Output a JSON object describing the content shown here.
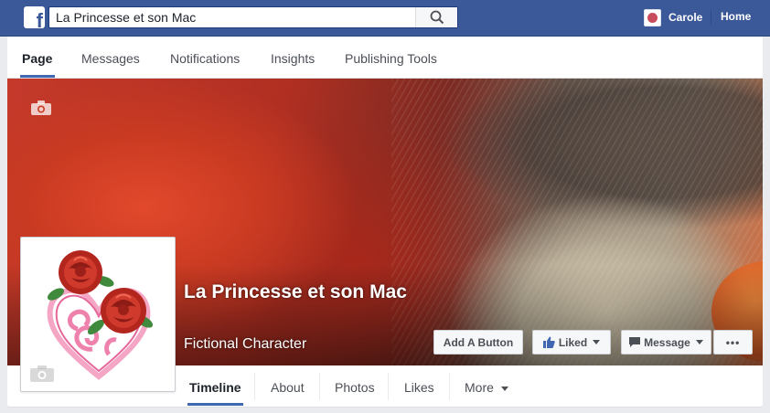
{
  "search": {
    "value": "La Princesse et son Mac"
  },
  "topbar": {
    "user_name": "Carole",
    "home_label": "Home"
  },
  "page_tabs": [
    {
      "label": "Page",
      "active": true
    },
    {
      "label": "Messages"
    },
    {
      "label": "Notifications"
    },
    {
      "label": "Insights"
    },
    {
      "label": "Publishing Tools"
    }
  ],
  "page": {
    "name": "La Princesse et son Mac",
    "category": "Fictional Character"
  },
  "actions": {
    "add_button": "Add A Button",
    "liked": "Liked",
    "message": "Message",
    "more": "•••"
  },
  "timeline_tabs": [
    {
      "label": "Timeline",
      "active": true
    },
    {
      "label": "About"
    },
    {
      "label": "Photos"
    },
    {
      "label": "Likes"
    },
    {
      "label": "More"
    }
  ],
  "colors": {
    "brand": "#3b5998",
    "accent": "#4267b2",
    "rose": "#c0392b"
  },
  "icons": [
    "facebook-logo-icon",
    "search-icon",
    "camera-icon",
    "thumbs-up-icon",
    "message-bubble-icon",
    "caret-down-icon"
  ]
}
